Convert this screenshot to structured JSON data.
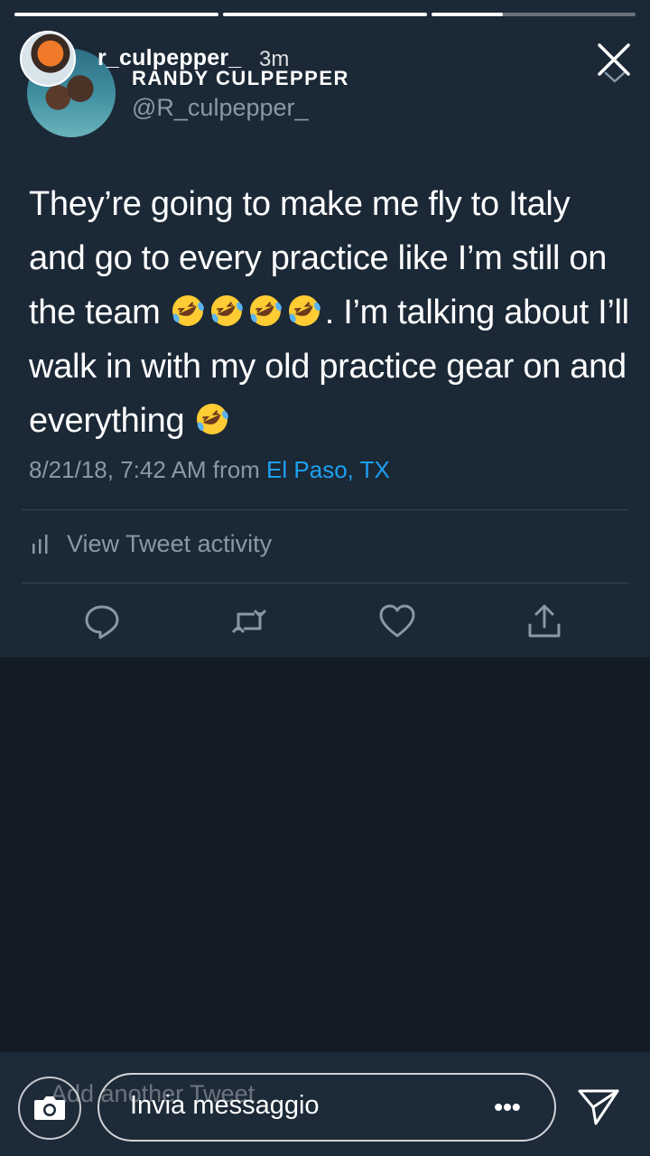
{
  "story": {
    "progress": [
      1.0,
      1.0,
      0.35
    ],
    "username": "r_culpepper_",
    "time": "3m"
  },
  "tweet": {
    "display_name": "RANDY CULPEPPER",
    "handle": "@R_culpepper_",
    "text_1": "They’re going to make me fly to Italy and go to every practice like I’m still on the team ",
    "text_2": ". I’m talking about I’ll walk in with my old practice gear on and everything ",
    "emoji": "rolling-on-the-floor-laughing",
    "timestamp": "8/21/18, 7:42 AM from ",
    "location": "El Paso, TX",
    "activity_label": "View Tweet activity"
  },
  "composer": {
    "hint": "Add another Tweet",
    "placeholder": "Invia messaggio",
    "more": "•••"
  },
  "colors": {
    "card_bg": "#1b2836",
    "link": "#1da1f2",
    "secondary_text": "#8899a6"
  }
}
